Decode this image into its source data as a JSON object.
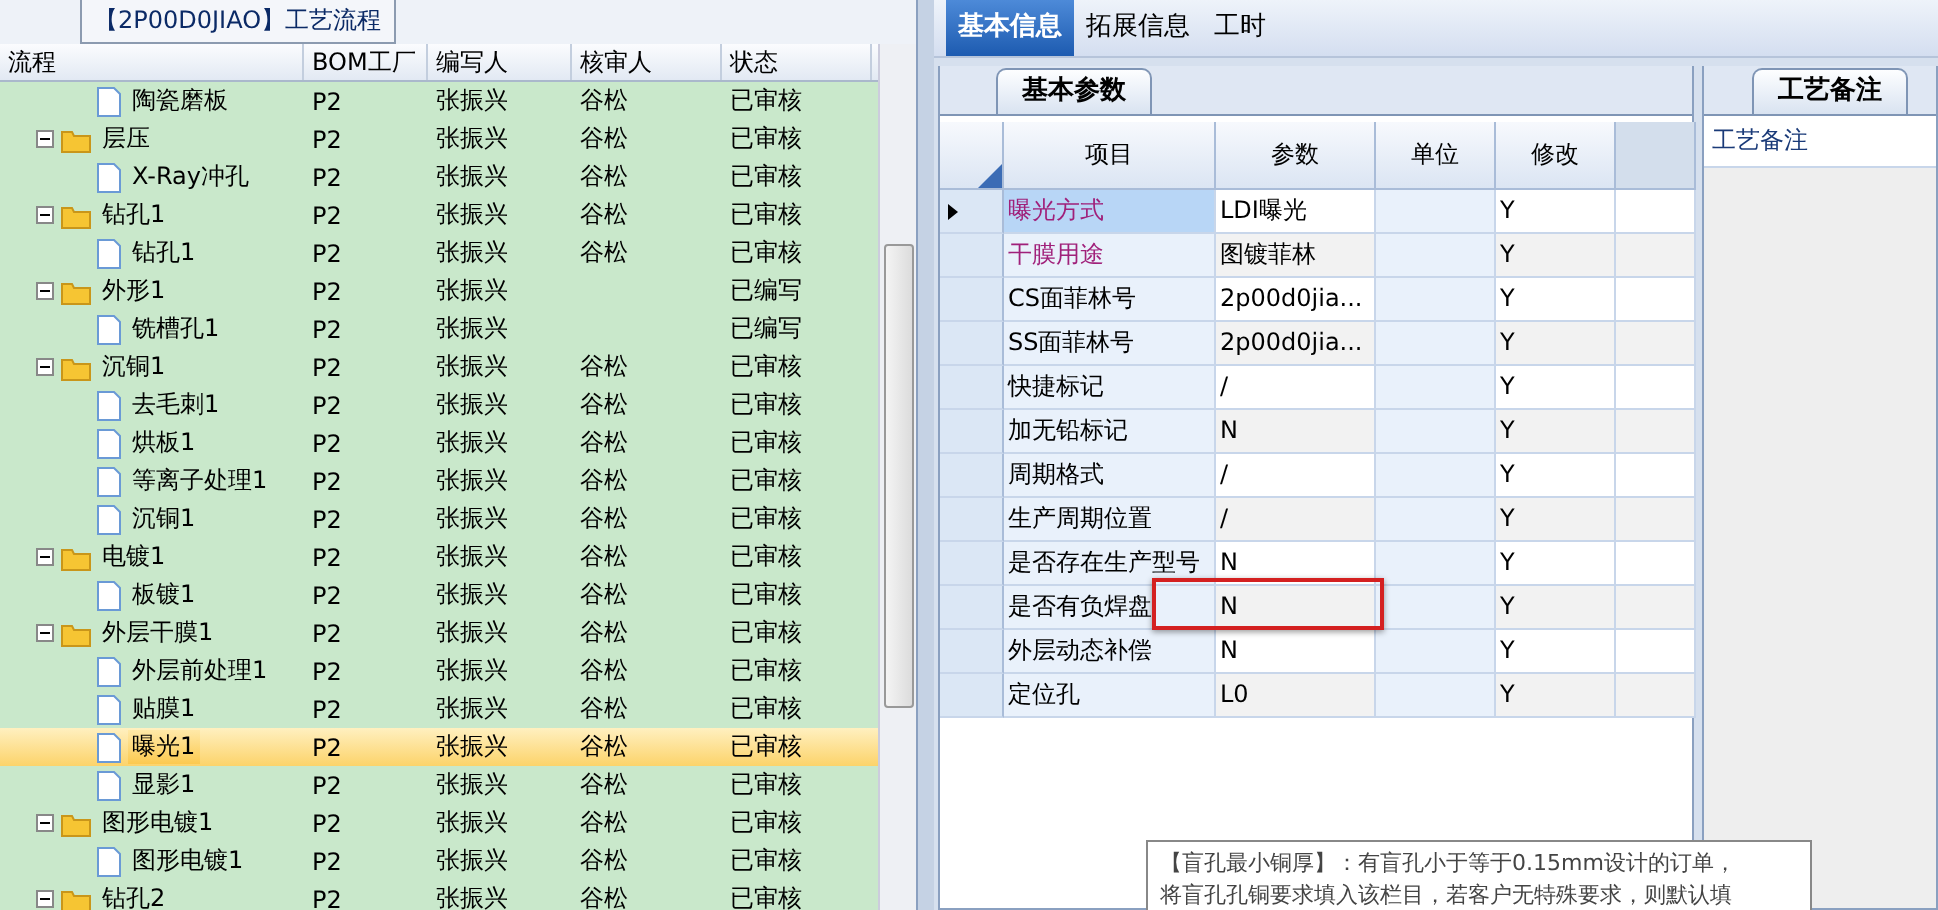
{
  "left_panel": {
    "title": "【2P00D0JIAO】工艺流程",
    "columns": [
      "流程",
      "BOM工厂",
      "编写人",
      "核审人",
      "状态"
    ],
    "tree": [
      {
        "kind": "file",
        "name": "陶瓷磨板",
        "bom": "P2",
        "writer": "张振兴",
        "reviewer": "谷松",
        "status": "已审核",
        "selected": false
      },
      {
        "kind": "folder",
        "name": "层压",
        "bom": "P2",
        "writer": "张振兴",
        "reviewer": "谷松",
        "status": "已审核",
        "selected": false,
        "expanded": true,
        "children": [
          {
            "kind": "file",
            "name": "X-Ray冲孔",
            "bom": "P2",
            "writer": "张振兴",
            "reviewer": "谷松",
            "status": "已审核",
            "selected": false
          }
        ]
      },
      {
        "kind": "folder",
        "name": "钻孔1",
        "bom": "P2",
        "writer": "张振兴",
        "reviewer": "谷松",
        "status": "已审核",
        "selected": false,
        "expanded": true,
        "children": [
          {
            "kind": "file",
            "name": "钻孔1",
            "bom": "P2",
            "writer": "张振兴",
            "reviewer": "谷松",
            "status": "已审核",
            "selected": false
          }
        ]
      },
      {
        "kind": "folder",
        "name": "外形1",
        "bom": "P2",
        "writer": "张振兴",
        "status": "已编写",
        "selected": false,
        "expanded": true,
        "children": [
          {
            "kind": "file",
            "name": "铣槽孔1",
            "bom": "P2",
            "writer": "张振兴",
            "status": "已编写",
            "selected": false
          }
        ]
      },
      {
        "kind": "folder",
        "name": "沉铜1",
        "bom": "P2",
        "writer": "张振兴",
        "reviewer": "谷松",
        "status": "已审核",
        "selected": false,
        "expanded": true,
        "children": [
          {
            "kind": "file",
            "name": "去毛刺1",
            "bom": "P2",
            "writer": "张振兴",
            "reviewer": "谷松",
            "status": "已审核",
            "selected": false
          },
          {
            "kind": "file",
            "name": "烘板1",
            "bom": "P2",
            "writer": "张振兴",
            "reviewer": "谷松",
            "status": "已审核",
            "selected": false
          },
          {
            "kind": "file",
            "name": "等离子处理1",
            "bom": "P2",
            "writer": "张振兴",
            "reviewer": "谷松",
            "status": "已审核",
            "selected": false
          },
          {
            "kind": "file",
            "name": "沉铜1",
            "bom": "P2",
            "writer": "张振兴",
            "reviewer": "谷松",
            "status": "已审核",
            "selected": false
          }
        ]
      },
      {
        "kind": "folder",
        "name": "电镀1",
        "bom": "P2",
        "writer": "张振兴",
        "reviewer": "谷松",
        "status": "已审核",
        "selected": false,
        "expanded": true,
        "children": [
          {
            "kind": "file",
            "name": "板镀1",
            "bom": "P2",
            "writer": "张振兴",
            "reviewer": "谷松",
            "status": "已审核",
            "selected": false
          }
        ]
      },
      {
        "kind": "folder",
        "name": "外层干膜1",
        "bom": "P2",
        "writer": "张振兴",
        "reviewer": "谷松",
        "status": "已审核",
        "selected": false,
        "expanded": true,
        "children": [
          {
            "kind": "file",
            "name": "外层前处理1",
            "bom": "P2",
            "writer": "张振兴",
            "reviewer": "谷松",
            "status": "已审核",
            "selected": false
          },
          {
            "kind": "file",
            "name": "贴膜1",
            "bom": "P2",
            "writer": "张振兴",
            "reviewer": "谷松",
            "status": "已审核",
            "selected": false
          },
          {
            "kind": "file",
            "name": "曝光1",
            "bom": "P2",
            "writer": "张振兴",
            "reviewer": "谷松",
            "status": "已审核",
            "selected": true
          },
          {
            "kind": "file",
            "name": "显影1",
            "bom": "P2",
            "writer": "张振兴",
            "reviewer": "谷松",
            "status": "已审核",
            "selected": false
          }
        ]
      },
      {
        "kind": "folder",
        "name": "图形电镀1",
        "bom": "P2",
        "writer": "张振兴",
        "reviewer": "谷松",
        "status": "已审核",
        "selected": false,
        "expanded": true,
        "children": [
          {
            "kind": "file",
            "name": "图形电镀1",
            "bom": "P2",
            "writer": "张振兴",
            "reviewer": "谷松",
            "status": "已审核",
            "selected": false
          }
        ]
      },
      {
        "kind": "folder",
        "name": "钻孔2",
        "bom": "P2",
        "writer": "张振兴",
        "reviewer": "谷松",
        "status": "已审核",
        "selected": false,
        "expanded": true
      }
    ]
  },
  "tabs": [
    {
      "label": "基本信息",
      "selected": true
    },
    {
      "label": "拓展信息",
      "selected": false
    },
    {
      "label": "工时",
      "selected": false
    }
  ],
  "params_panel": {
    "tab": "基本参数",
    "columns": [
      "项目",
      "参数",
      "单位",
      "修改"
    ],
    "rows": [
      {
        "item": "曝光方式",
        "value": "LDI曝光",
        "modify": "Y",
        "color": "#a0207a",
        "current": true,
        "marked": false
      },
      {
        "item": "干膜用途",
        "value": "图镀菲林",
        "modify": "Y",
        "color": "#a0207a",
        "current": false,
        "marked": false
      },
      {
        "item": "CS面菲林号",
        "value": "2p00d0jia...",
        "modify": "Y",
        "color": "#000000",
        "current": false,
        "marked": false
      },
      {
        "item": "SS面菲林号",
        "value": "2p00d0jia...",
        "modify": "Y",
        "color": "#000000",
        "current": false,
        "marked": false
      },
      {
        "item": "快捷标记",
        "value": "/",
        "modify": "Y",
        "color": "#000000",
        "current": false,
        "marked": false
      },
      {
        "item": "加无铅标记",
        "value": "N",
        "modify": "Y",
        "color": "#000000",
        "current": false,
        "marked": false
      },
      {
        "item": "周期格式",
        "value": "/",
        "modify": "Y",
        "color": "#000000",
        "current": false,
        "marked": false
      },
      {
        "item": "生产周期位置",
        "value": "/",
        "modify": "Y",
        "color": "#000000",
        "current": false,
        "marked": false
      },
      {
        "item": "是否存在生产型号",
        "value": "N",
        "modify": "Y",
        "color": "#000000",
        "current": false,
        "marked": false
      },
      {
        "item": "是否有负焊盘",
        "value": "N",
        "modify": "Y",
        "color": "#000000",
        "current": false,
        "marked": true
      },
      {
        "item": "外层动态补偿",
        "value": "N",
        "modify": "Y",
        "color": "#000000",
        "current": false,
        "marked": false
      },
      {
        "item": "定位孔",
        "value": "L0",
        "modify": "Y",
        "color": "#000000",
        "current": false,
        "marked": false
      }
    ]
  },
  "notes_panel": {
    "tab": "工艺备注",
    "label": "工艺备注"
  },
  "tooltip": {
    "lines": [
      "【盲孔最小铜厚】：有盲孔小于等于0.15mm设计的订单，",
      "将盲孔孔铜要求填入该栏目，若客户无特殊要求，则默认填"
    ]
  }
}
